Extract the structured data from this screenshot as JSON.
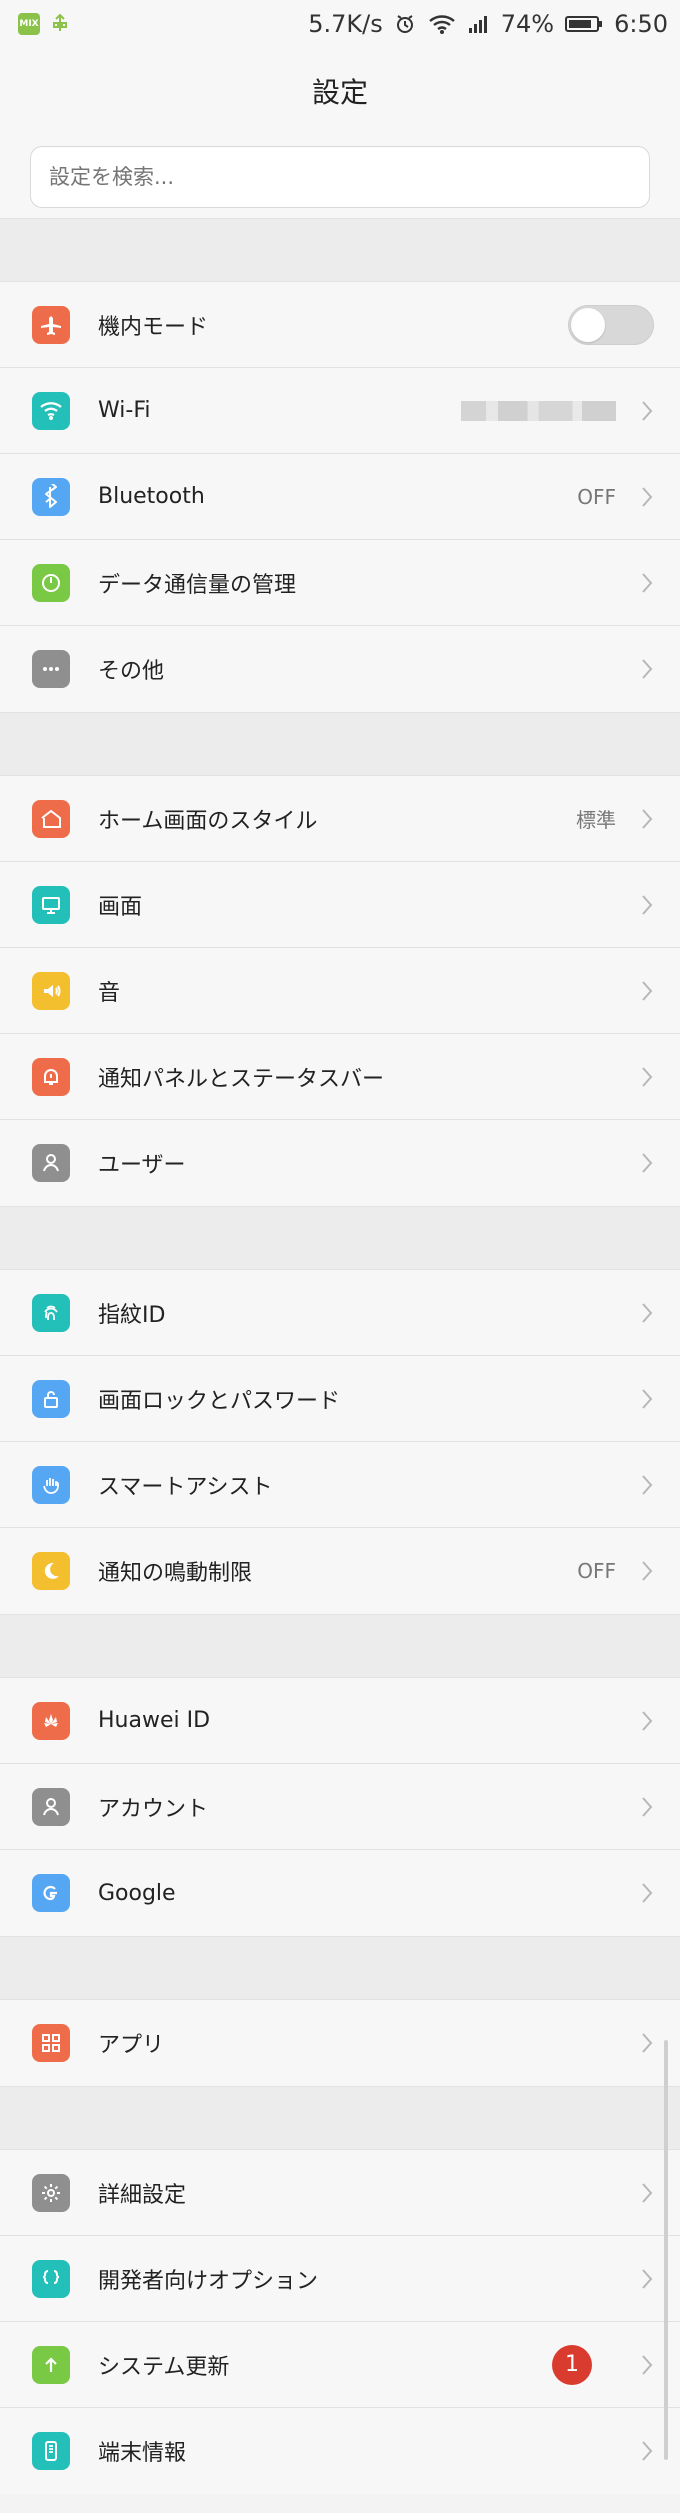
{
  "status": {
    "left_badge": "MIX",
    "network_speed": "5.7K/s",
    "battery_percent": "74%",
    "time": "6:50"
  },
  "header": {
    "title": "設定"
  },
  "search": {
    "placeholder": "設定を検索..."
  },
  "sections": [
    {
      "items": [
        {
          "label": "機内モード",
          "icon": "airplane-icon",
          "color": "#ef6c4a",
          "control": "toggle",
          "value": "off"
        },
        {
          "label": "Wi-Fi",
          "icon": "wifi-icon",
          "color": "#22c0b8",
          "value": ""
        },
        {
          "label": "Bluetooth",
          "icon": "bluetooth-icon",
          "color": "#56a7f3",
          "value": "OFF"
        },
        {
          "label": "データ通信量の管理",
          "icon": "data-usage-icon",
          "color": "#79c944",
          "value": ""
        },
        {
          "label": "その他",
          "icon": "more-icon",
          "color": "#8f8f8f",
          "value": ""
        }
      ]
    },
    {
      "items": [
        {
          "label": "ホーム画面のスタイル",
          "icon": "home-icon",
          "color": "#ef6c4a",
          "value": "標準"
        },
        {
          "label": "画面",
          "icon": "display-icon",
          "color": "#22c0b8",
          "value": ""
        },
        {
          "label": "音",
          "icon": "speaker-icon",
          "color": "#f4bf2e",
          "value": ""
        },
        {
          "label": "通知パネルとステータスバー",
          "icon": "notification-icon",
          "color": "#ef6c4a",
          "value": ""
        },
        {
          "label": "ユーザー",
          "icon": "user-icon",
          "color": "#8f8f8f",
          "value": ""
        }
      ]
    },
    {
      "items": [
        {
          "label": "指紋ID",
          "icon": "fingerprint-icon",
          "color": "#22c0b8",
          "value": ""
        },
        {
          "label": "画面ロックとパスワード",
          "icon": "lock-icon",
          "color": "#56a7f3",
          "value": ""
        },
        {
          "label": "スマートアシスト",
          "icon": "hand-icon",
          "color": "#56a7f3",
          "value": ""
        },
        {
          "label": "通知の鳴動制限",
          "icon": "moon-icon",
          "color": "#f4bf2e",
          "value": "OFF"
        }
      ]
    },
    {
      "items": [
        {
          "label": "Huawei ID",
          "icon": "huawei-icon",
          "color": "#ef6c4a",
          "value": ""
        },
        {
          "label": "アカウント",
          "icon": "account-icon",
          "color": "#8f8f8f",
          "value": ""
        },
        {
          "label": "Google",
          "icon": "google-icon",
          "color": "#56a7f3",
          "value": ""
        }
      ]
    },
    {
      "items": [
        {
          "label": "アプリ",
          "icon": "apps-icon",
          "color": "#ef6c4a",
          "value": ""
        }
      ]
    },
    {
      "items": [
        {
          "label": "詳細設定",
          "icon": "gear-icon",
          "color": "#8f8f8f",
          "value": ""
        },
        {
          "label": "開発者向けオプション",
          "icon": "code-braces-icon",
          "color": "#22c0b8",
          "value": ""
        },
        {
          "label": "システム更新",
          "icon": "update-arrow-icon",
          "color": "#79c944",
          "value": "",
          "badge": "1"
        },
        {
          "label": "端末情報",
          "icon": "device-info-icon",
          "color": "#22c0b8",
          "value": ""
        }
      ]
    }
  ]
}
